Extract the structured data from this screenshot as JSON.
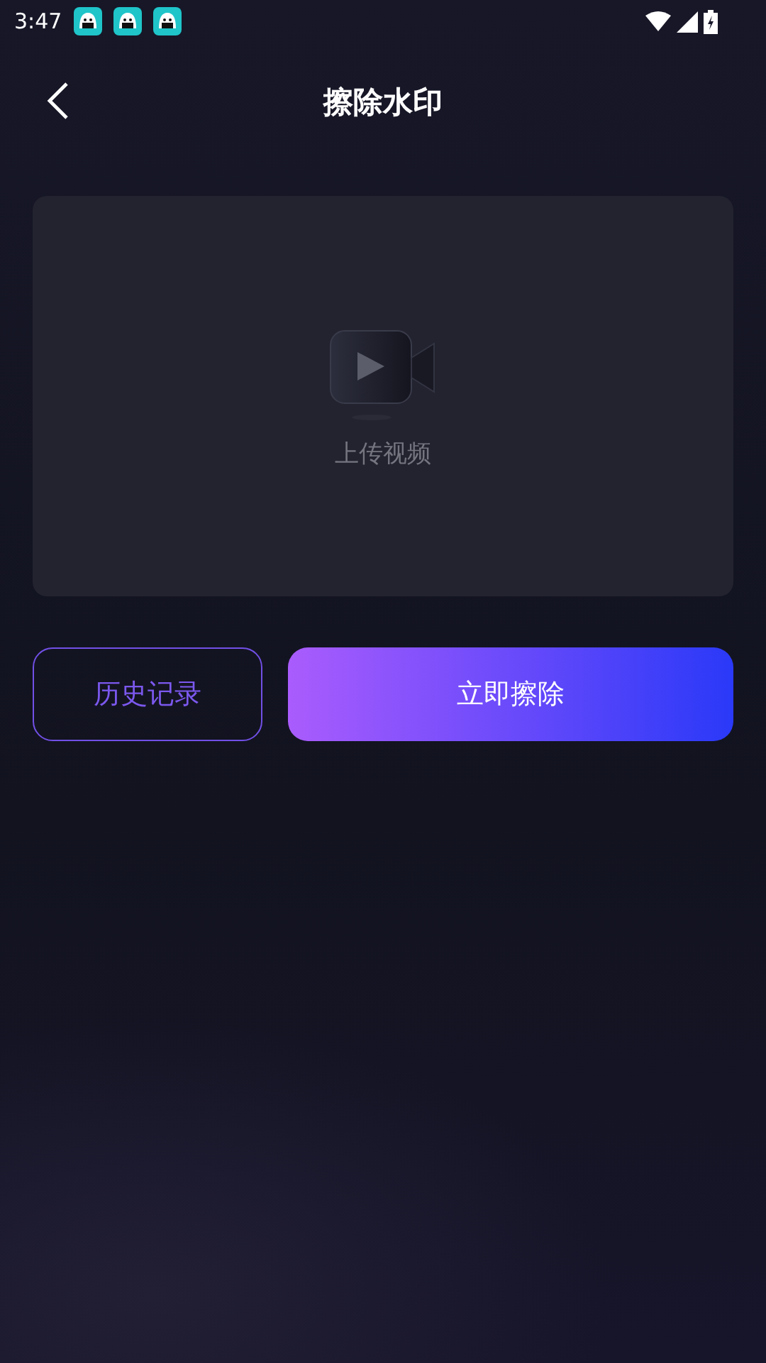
{
  "status_bar": {
    "time": "3:47",
    "notifications": [
      {
        "kind": "app"
      },
      {
        "kind": "app"
      },
      {
        "kind": "app"
      }
    ]
  },
  "header": {
    "title": "擦除水印"
  },
  "upload": {
    "label": "上传视频"
  },
  "buttons": [
    {
      "kind": "outline",
      "label": "历史记录"
    },
    {
      "kind": "gradient",
      "label": "立即擦除"
    }
  ]
}
